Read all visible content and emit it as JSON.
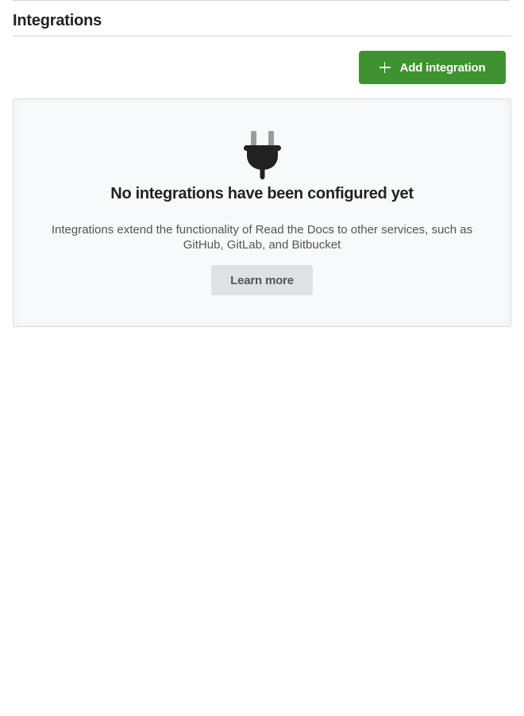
{
  "header": {
    "title": "Integrations"
  },
  "actions": {
    "add_label": "Add integration",
    "add_icon": "plus-icon"
  },
  "empty_state": {
    "icon": "plug-icon",
    "heading": "No integrations have been configured yet",
    "description": "Integrations extend the functionality of Read the Docs to other services, such as GitHub, GitLab, and Bitbucket",
    "learn_more_label": "Learn more"
  },
  "colors": {
    "primary": "#3e9230",
    "secondary_button": "#e0e1e2",
    "card_background": "#f8f9fa",
    "icon_dark": "#222222",
    "icon_prong": "#9c9c9c"
  }
}
